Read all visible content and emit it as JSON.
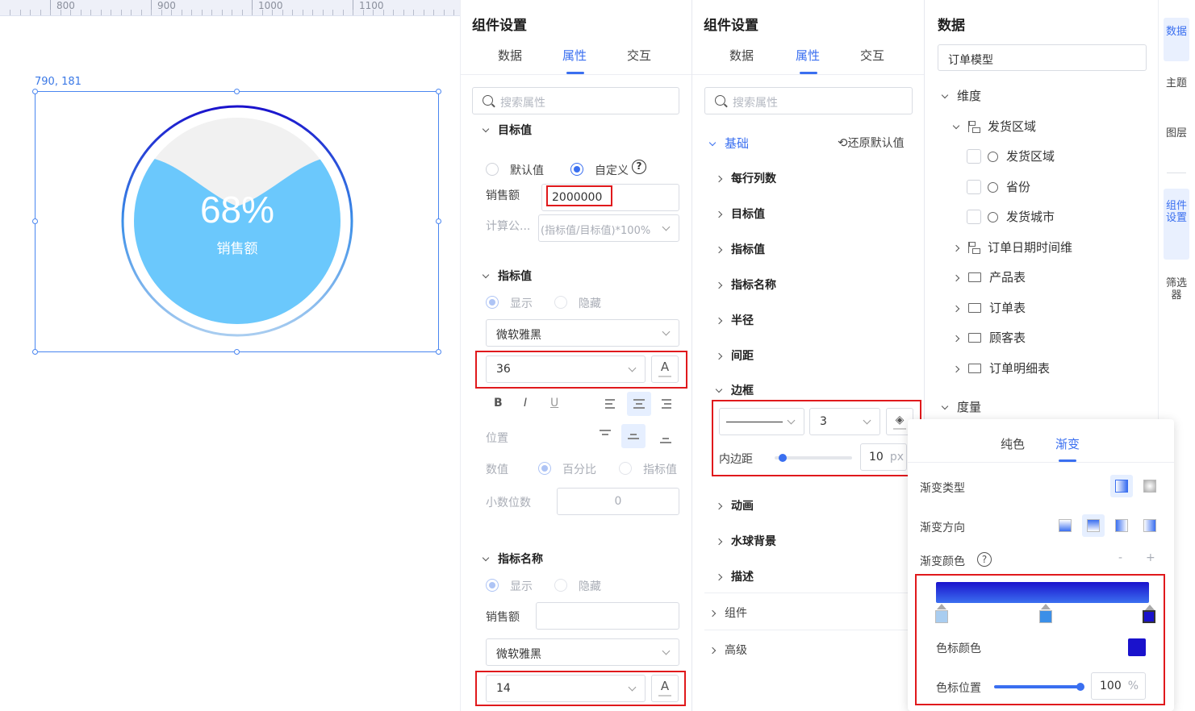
{
  "ruler": {
    "ticks": [
      "800",
      "900",
      "1000",
      "1100"
    ]
  },
  "canvas": {
    "coords": "790, 181",
    "gauge": {
      "percent": "68%",
      "label": "销售额",
      "fill": 0.68,
      "colors": {
        "ring_start": "#1a12cc",
        "ring_end": "#a9cdf0",
        "water": "#6bc8fc",
        "bg": "#f1f1f1"
      }
    }
  },
  "panel1": {
    "title": "组件设置",
    "tabs": [
      "数据",
      "属性",
      "交互"
    ],
    "search_placeholder": "搜索属性",
    "target": {
      "title": "目标值",
      "opt_default": "默认值",
      "opt_custom": "自定义",
      "help": "?",
      "sales_label": "销售额",
      "sales_value": "2000000",
      "formula_label": "计算公...",
      "formula_value": "(指标值/目标值)*100%"
    },
    "indicator": {
      "title": "指标值",
      "show": "显示",
      "hide": "隐藏",
      "font": "微软雅黑",
      "size": "36",
      "color_btn": "A",
      "bold": "B",
      "italic": "I",
      "underline": "U",
      "position_label": "位置",
      "number_label": "数值",
      "opt_percent": "百分比",
      "opt_value": "指标值",
      "decimal_label": "小数位数",
      "decimal_value": "0"
    },
    "indicator_name": {
      "title": "指标名称",
      "show": "显示",
      "hide": "隐藏",
      "name_label": "销售额",
      "name_value": "",
      "font": "微软雅黑",
      "size": "14",
      "color_btn": "A"
    }
  },
  "panel2": {
    "title": "组件设置",
    "tabs": [
      "数据",
      "属性",
      "交互"
    ],
    "search_placeholder": "搜索属性",
    "basic": "基础",
    "reset": "还原默认值",
    "sections": [
      "每行列数",
      "目标值",
      "指标值",
      "指标名称",
      "半径",
      "间距"
    ],
    "border": {
      "title": "边框",
      "width": "3",
      "padding_label": "内边距",
      "padding_value": "10",
      "padding_unit": "px",
      "padding_fill": 0.05
    },
    "sections2": [
      "动画",
      "水球背景",
      "描述"
    ],
    "groups": [
      "组件",
      "高级"
    ]
  },
  "panel3": {
    "title": "数据",
    "model": "订单模型",
    "dimension": "维度",
    "tree": [
      {
        "label": "发货区域",
        "type": "hier",
        "open": true
      },
      {
        "label": "发货区域",
        "type": "field"
      },
      {
        "label": "省份",
        "type": "field"
      },
      {
        "label": "发货城市",
        "type": "field"
      },
      {
        "label": "订单日期时间维",
        "type": "hier"
      },
      {
        "label": "产品表",
        "type": "folder"
      },
      {
        "label": "订单表",
        "type": "folder"
      },
      {
        "label": "顾客表",
        "type": "folder"
      },
      {
        "label": "订单明细表",
        "type": "folder"
      }
    ],
    "measure": "度量"
  },
  "rail": {
    "items": [
      "数据",
      "主题",
      "图层",
      "组件设置",
      "筛选器"
    ]
  },
  "gradient_popup": {
    "tabs": [
      "纯色",
      "渐变"
    ],
    "type_label": "渐变类型",
    "direction_label": "渐变方向",
    "colors_label": "渐变颜色",
    "help": "?",
    "minus": "-",
    "plus": "+",
    "stops": [
      {
        "color": "#a9cdf0",
        "pos": 0
      },
      {
        "color": "#3b8fe8",
        "pos": 50
      },
      {
        "color": "#1a12cc",
        "pos": 100
      }
    ],
    "stop_color_label": "色标颜色",
    "stop_color": "#1a12cc",
    "stop_pos_label": "色标位置",
    "stop_pos_value": "100",
    "stop_pos_unit": "%"
  }
}
